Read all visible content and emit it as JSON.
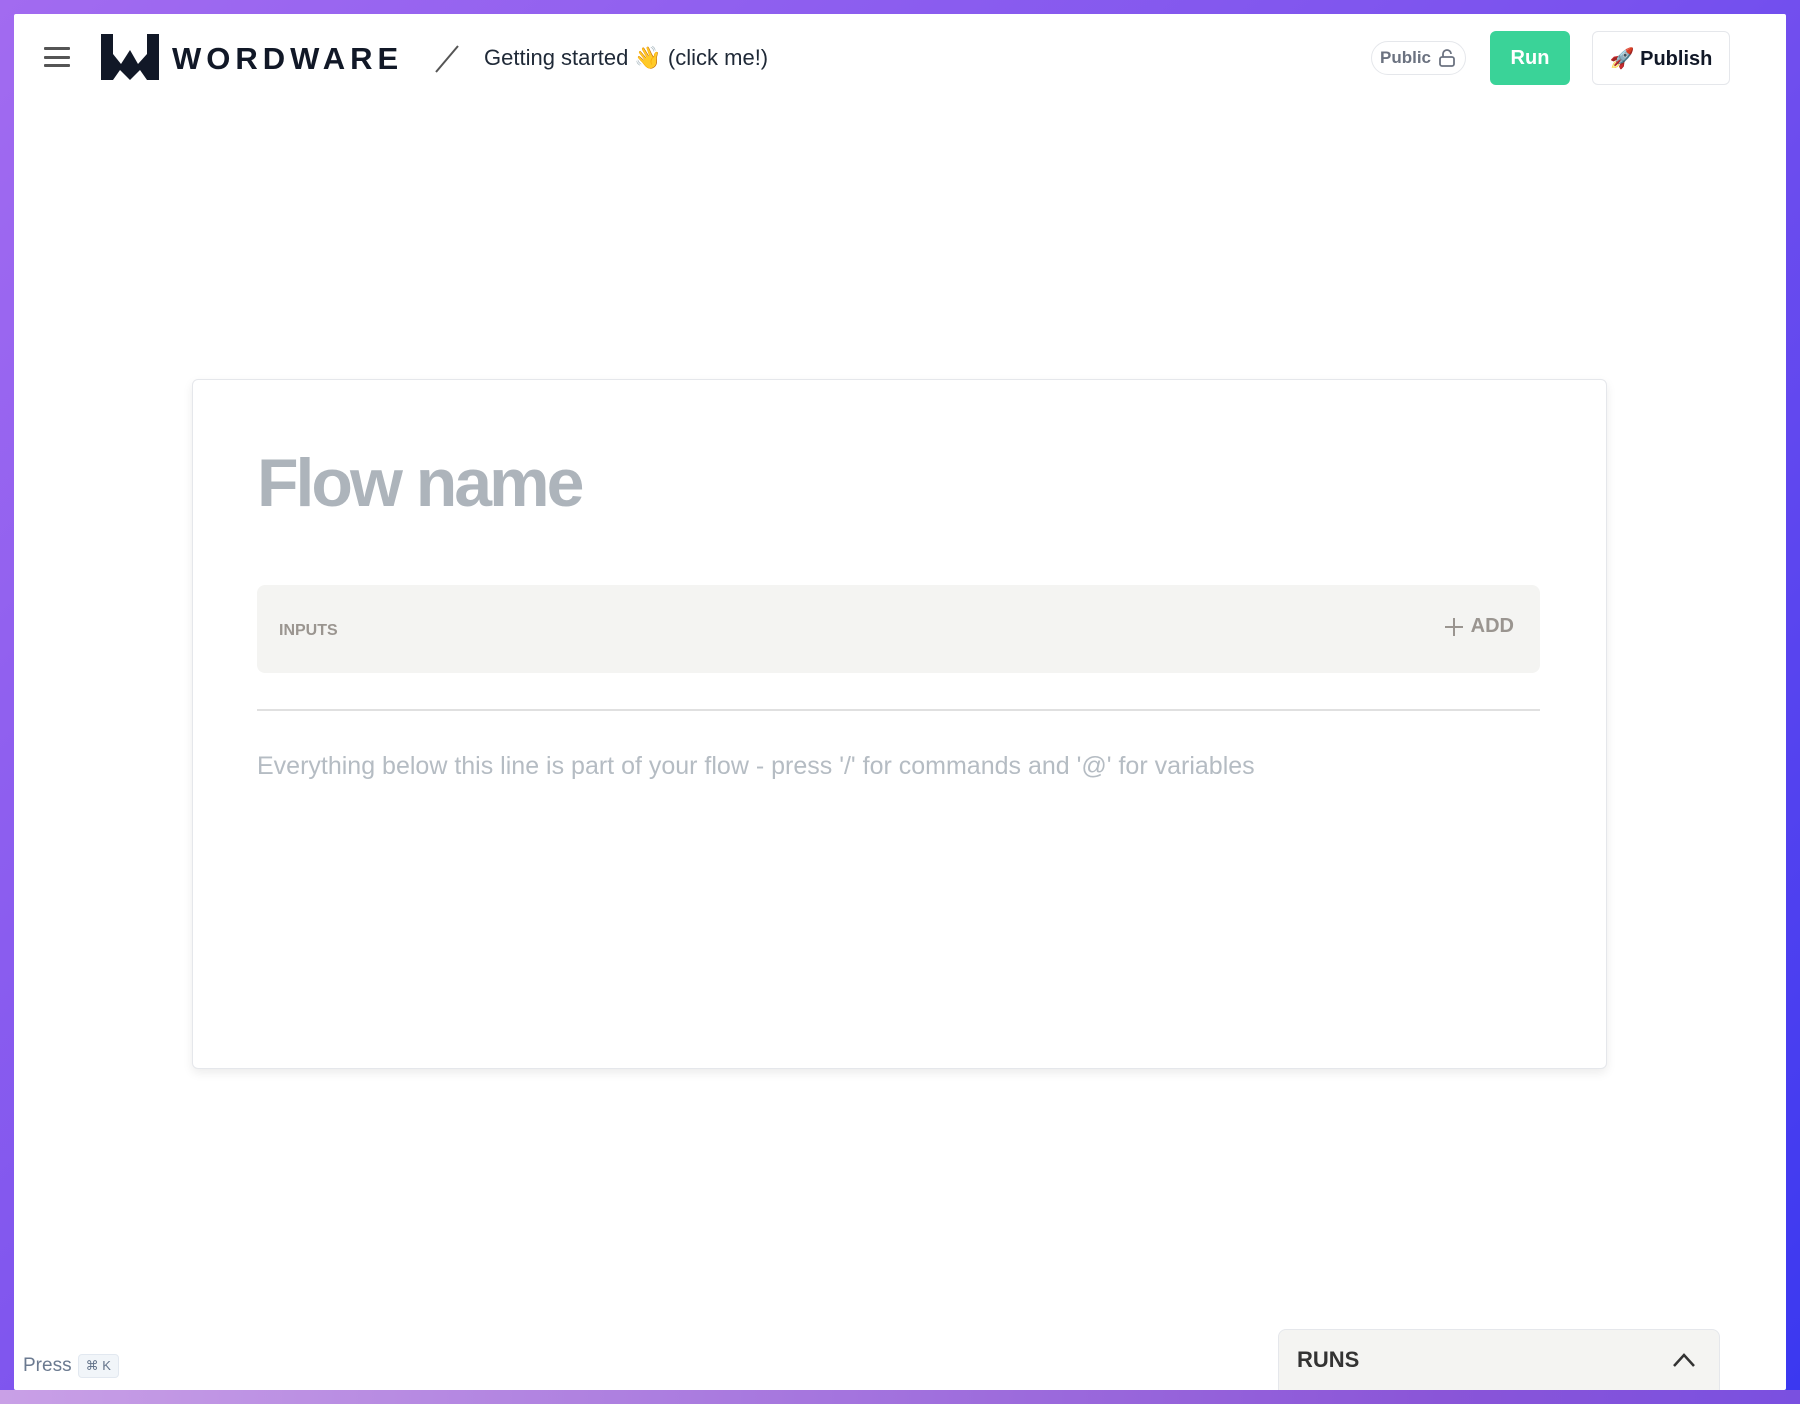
{
  "header": {
    "brand": "WORDWARE",
    "title": "Getting started 👋 (click me!)",
    "visibility_label": "Public",
    "run_label": "Run",
    "publish_label": "🚀 Publish"
  },
  "editor": {
    "flow_name_placeholder": "Flow name",
    "inputs_label": "INPUTS",
    "add_label": "ADD",
    "body_placeholder": "Everything below this line is part of your flow - press '/' for commands and '@' for variables"
  },
  "footer": {
    "press_label": "Press",
    "shortcut": "⌘ K",
    "runs_label": "RUNS"
  },
  "colors": {
    "accent": "#3ad398",
    "brand": "#111827"
  }
}
